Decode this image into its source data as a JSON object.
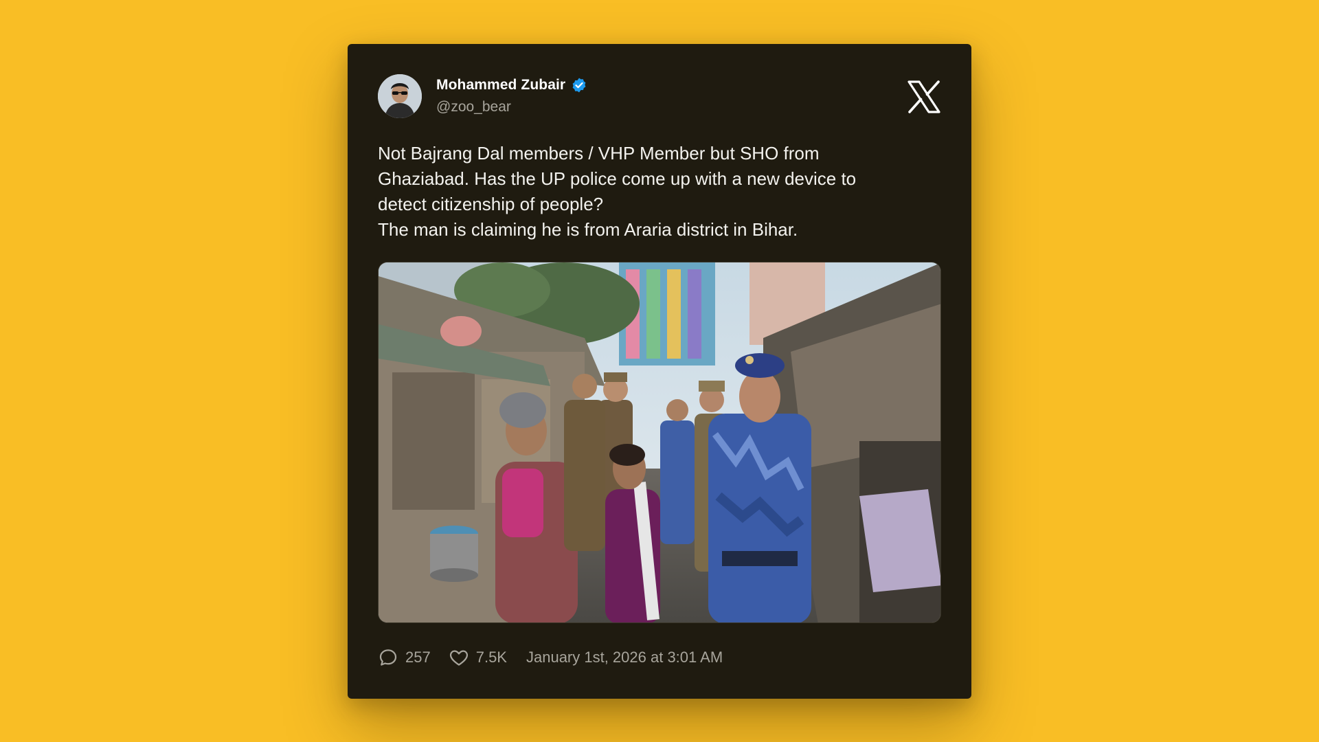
{
  "author": {
    "display_name": "Mohammed Zubair",
    "handle": "@zoo_bear",
    "verified": true,
    "avatar_icon": "user-avatar"
  },
  "platform_icon": "x-logo-icon",
  "tweet": {
    "lines": [
      "Not Bajrang Dal members / VHP Member but SHO from",
      "Ghaziabad. Has the UP police come up with a new device to",
      "detect citizenship of people?",
      "The man is claiming he is from Araria district in Bihar."
    ]
  },
  "media": {
    "type": "video-thumbnail"
  },
  "stats": {
    "replies": "257",
    "likes": "7.5K",
    "timestamp": "January 1st, 2026 at 3:01 AM"
  },
  "colors": {
    "background": "#F9BE25",
    "card": "#1F1B10",
    "verified_blue": "#1D9BF0",
    "muted_text": "#A8A59C"
  }
}
